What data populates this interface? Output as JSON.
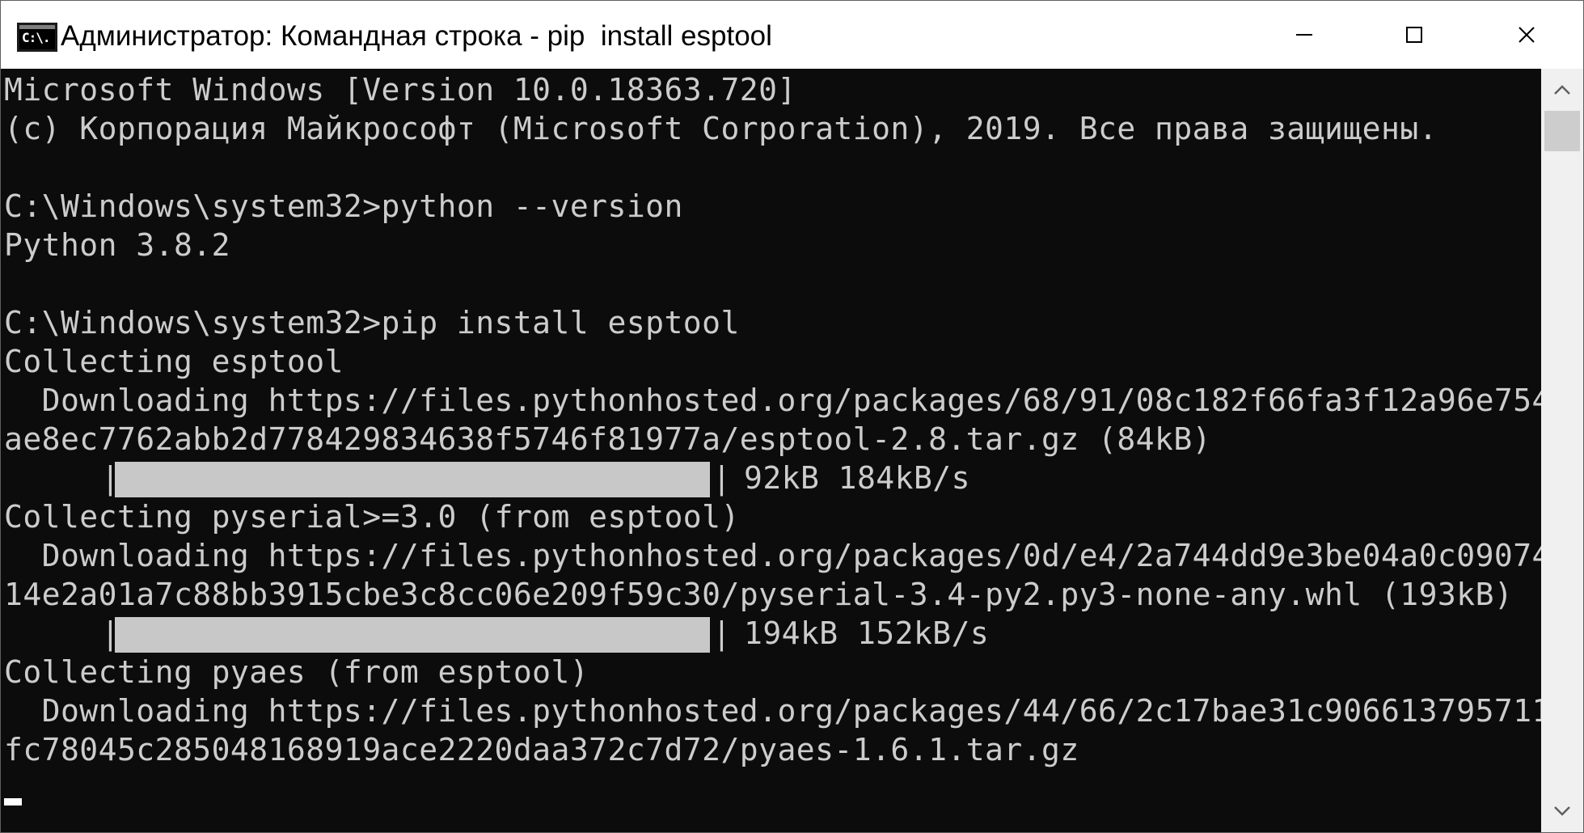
{
  "window": {
    "title": "Администратор: Командная строка - pip  install esptool",
    "icon_text": "C:\\."
  },
  "titlebar": {
    "minimize_icon": "minimize-icon",
    "maximize_icon": "maximize-icon",
    "close_icon": "close-icon"
  },
  "console": {
    "lines": [
      "Microsoft Windows [Version 10.0.18363.720]",
      "(c) Корпорация Майкрософт (Microsoft Corporation), 2019. Все права защищены.",
      "",
      "C:\\Windows\\system32>python --version",
      "Python 3.8.2",
      "",
      "C:\\Windows\\system32>pip install esptool",
      "Collecting esptool",
      "  Downloading https://files.pythonhosted.org/packages/68/91/08c182f66fa3f12a96e754",
      "ae8ec7762abb2d778429834638f5746f81977a/esptool-2.8.tar.gz (84kB)",
      "",
      "Collecting pyserial>=3.0 (from esptool)",
      "  Downloading https://files.pythonhosted.org/packages/0d/e4/2a744dd9e3be04a0c09074",
      "14e2a01a7c88bb3915cbe3c8cc06e209f59c30/pyserial-3.4-py2.py3-none-any.whl (193kB)",
      "",
      "Collecting pyaes (from esptool)",
      "  Downloading https://files.pythonhosted.org/packages/44/66/2c17bae31c906613795711",
      "fc78045c285048168919ace2220daa372c7d72/pyaes-1.6.1.tar.gz"
    ],
    "progress": [
      {
        "left_pipe": "|",
        "right_pipe": "|",
        "stats": "92kB 184kB/s",
        "fill": 1.0
      },
      {
        "left_pipe": "|",
        "right_pipe": "|",
        "stats": "194kB 152kB/s",
        "fill": 1.0
      }
    ]
  },
  "colors": {
    "console_bg": "#0c0c0c",
    "console_text": "#cccccc",
    "progress_fill": "#c8c8c8"
  }
}
